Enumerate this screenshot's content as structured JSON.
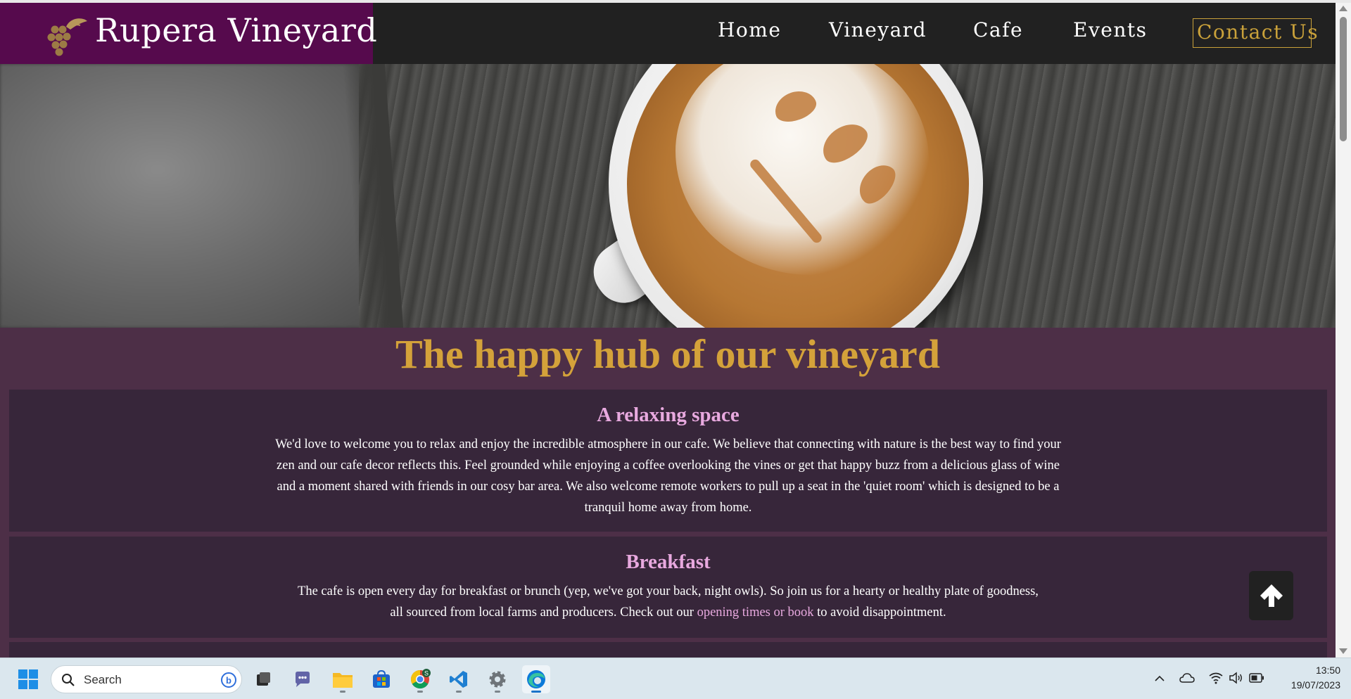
{
  "site": {
    "brand_name": "Rupera Vineyard",
    "nav": {
      "home": "Home",
      "vineyard": "Vineyard",
      "cafe": "Cafe",
      "events": "Events",
      "contact": "Contact Us"
    },
    "main_heading": "The happy hub of our vineyard",
    "sections": [
      {
        "title": "A relaxing space",
        "text": "We'd love to welcome you to relax and enjoy the incredible atmosphere in our cafe. We believe that connecting with nature is the best way to find your zen and our cafe decor reflects this. Feel grounded while enjoying a coffee overlooking the vines or get that happy buzz from a delicious glass of wine and a moment shared with friends in our cosy bar area. We also welcome remote workers to pull up a seat in the 'quiet room' which is designed to be a tranquil home away from home."
      },
      {
        "title": "Breakfast",
        "text_before": "The cafe is open every day for breakfast or brunch (yep, we've got your back, night owls). So join us for a hearty or healthy plate of goodness, all sourced from local farms and producers. Check out our ",
        "link": "opening times or book",
        "text_after": " to avoid disappointment."
      }
    ],
    "back_to_top_icon": "arrow-up-icon",
    "colors": {
      "brand_bg": "#560a4d",
      "nav_bg": "#212121",
      "page_bg": "#4d2f47",
      "card_bg": "#37263a",
      "heading_gold": "#d4a23a",
      "section_title_pink": "#e8a9df"
    }
  },
  "taskbar": {
    "search_placeholder": "Search",
    "apps": [
      "windows-start-icon",
      "file-explorer-icon",
      "teams-chat-icon",
      "folder-icon",
      "microsoft-store-icon",
      "chrome-icon",
      "vscode-icon",
      "settings-icon",
      "edge-icon"
    ],
    "time": "13:50",
    "date": "19/07/2023"
  }
}
